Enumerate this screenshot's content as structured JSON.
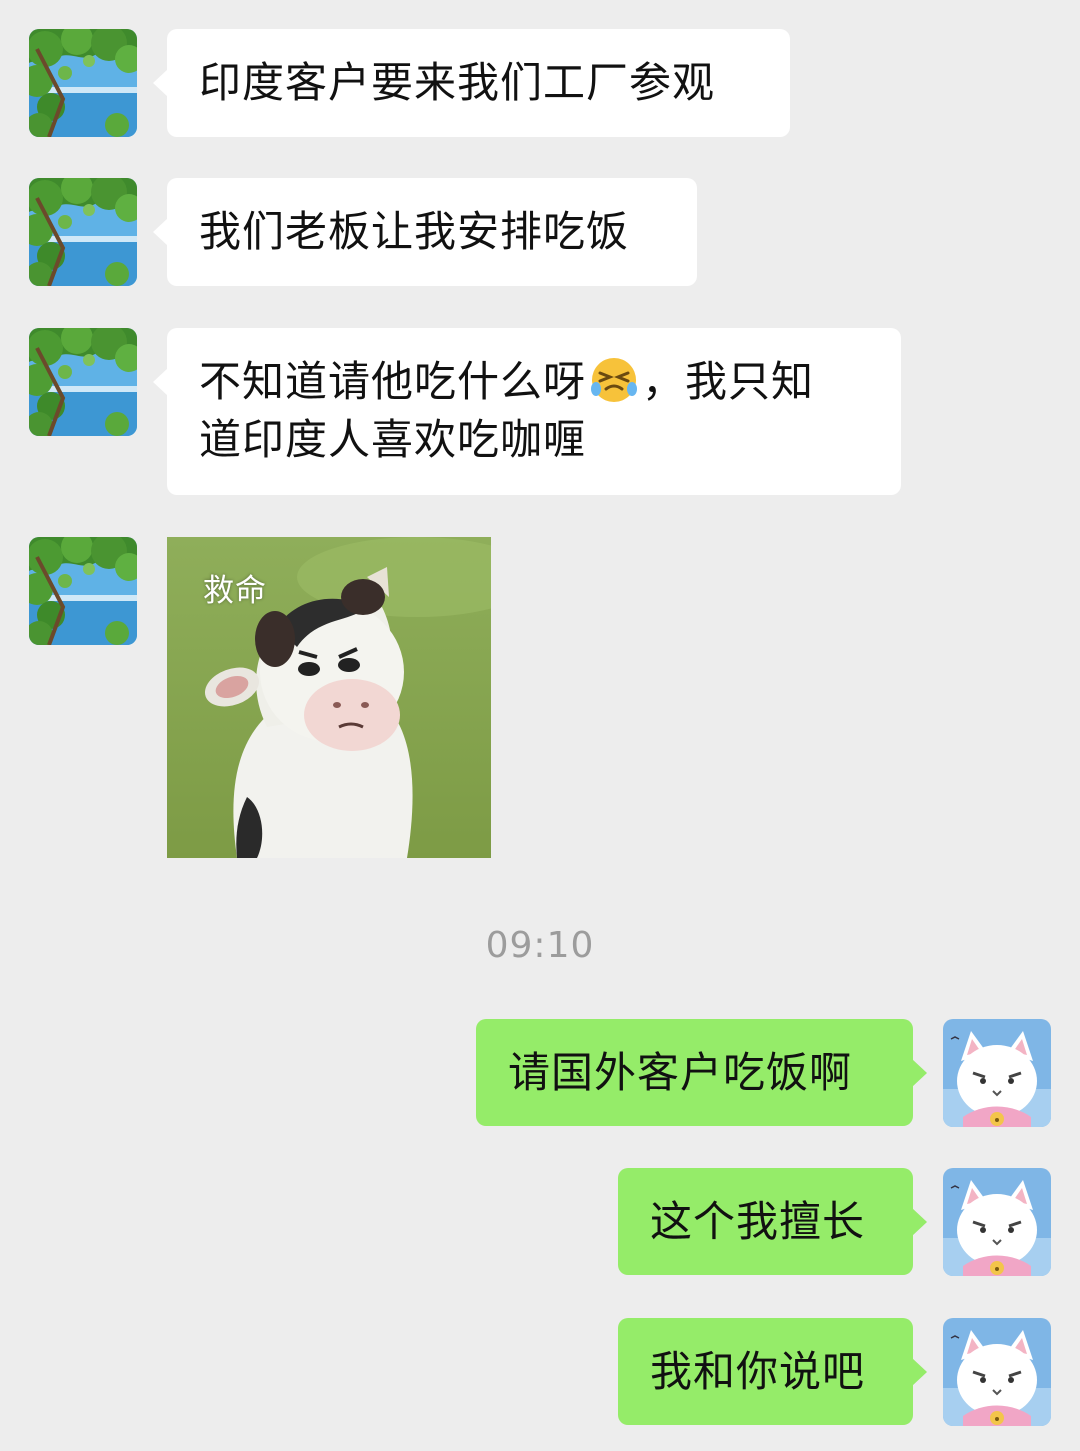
{
  "chat": {
    "incoming": [
      {
        "text": "印度客户要来我们工厂参观"
      },
      {
        "text": "我们老板让我安排吃饭"
      },
      {
        "text_before": "不知道请他吃什么呀",
        "emoji": "grinning-squinting-tears-emoji",
        "text_after": "，我只知",
        "text_line2": "道印度人喜欢吃咖喱"
      }
    ],
    "sticker": {
      "caption": "救命",
      "image": "cartoon-cow-holding-head-sticker"
    },
    "timestamp": "09:10",
    "outgoing": [
      {
        "text": "请国外客户吃饭啊"
      },
      {
        "text": "这个我擅长"
      },
      {
        "text": "我和你说吧"
      }
    ]
  },
  "colors": {
    "background": "#ededed",
    "incoming_bubble": "#ffffff",
    "outgoing_bubble": "#95ec69",
    "timestamp_text": "#9c9c9c"
  },
  "icons": {
    "contact_avatar": "tree-sky-avatar-icon",
    "self_avatar": "white-cat-avatar-icon"
  }
}
